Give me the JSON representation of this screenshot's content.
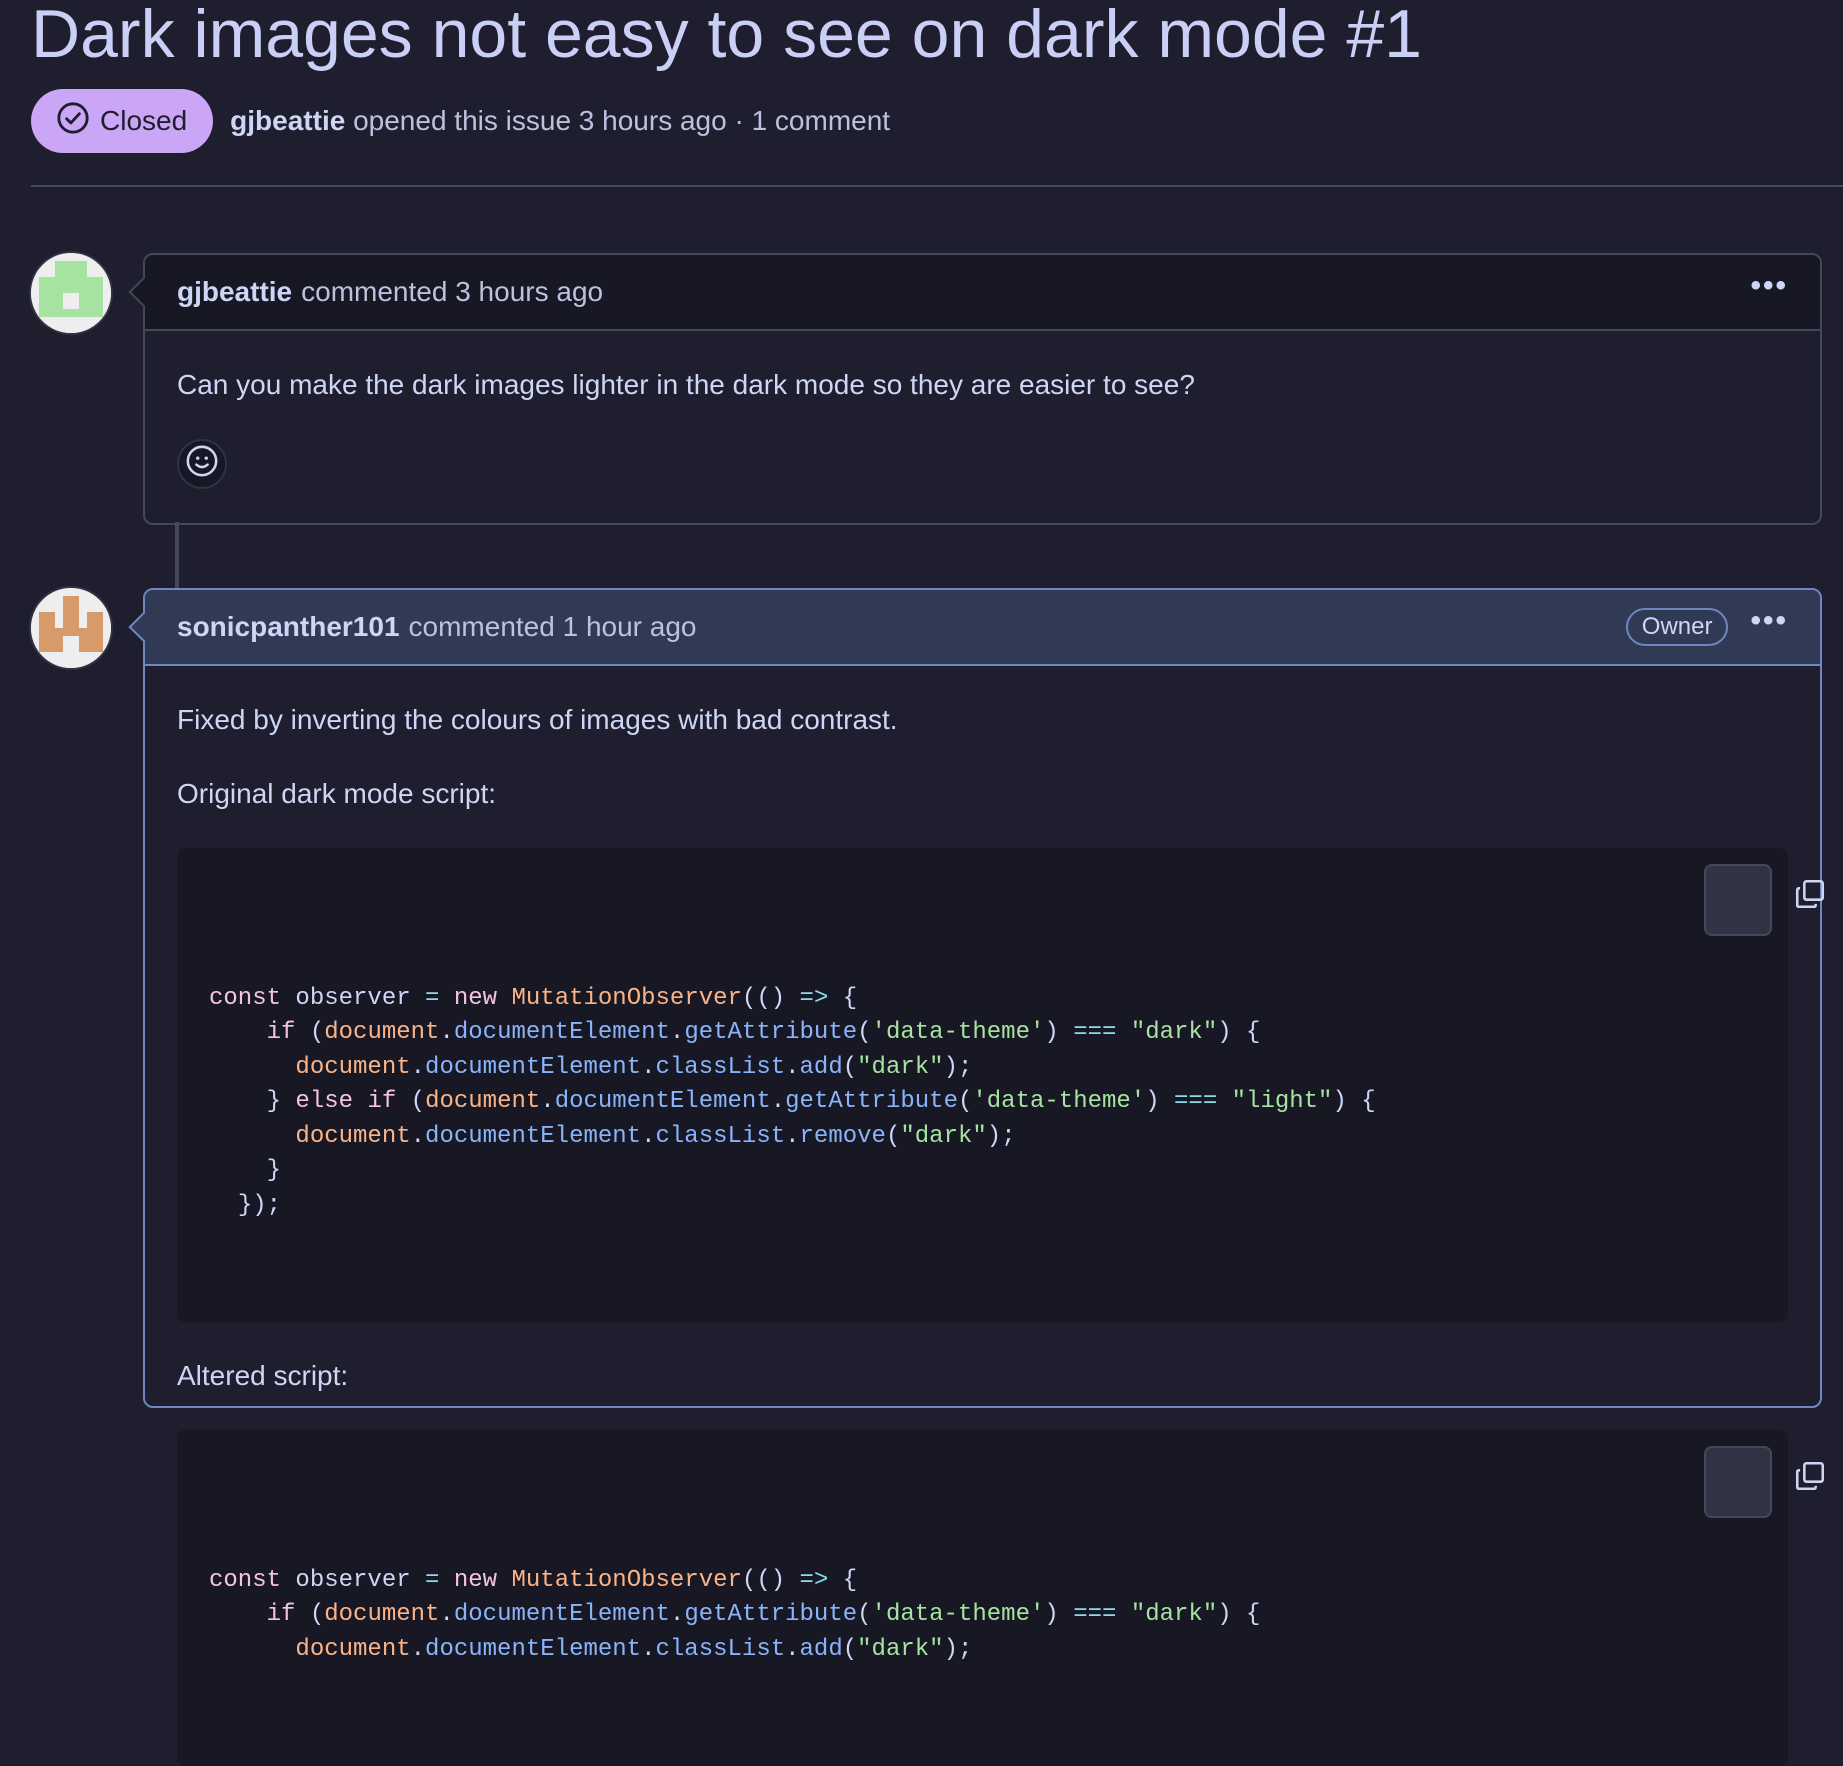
{
  "issue": {
    "title": "Dark images not easy to see on dark mode #1",
    "state": "Closed",
    "author": "gjbeattie",
    "meta_text": "opened this issue 3 hours ago · 1 comment"
  },
  "comments": [
    {
      "author": "gjbeattie",
      "time_text": "commented 3 hours ago",
      "body": "Can you make the dark images lighter in the dark mode so they are easier to see?",
      "menu": "•••"
    },
    {
      "author": "sonicpanther101",
      "time_text": "commented 1 hour ago",
      "badge": "Owner",
      "menu": "•••",
      "para1": "Fixed by inverting the colours of images with bad contrast.",
      "para2": "Original dark mode script:",
      "para3": "Altered script:"
    }
  ],
  "code_original": [
    "const observer = new MutationObserver(() => {",
    "    if (document.documentElement.getAttribute('data-theme') === \"dark\") {",
    "      document.documentElement.classList.add(\"dark\");",
    "    } else if (document.documentElement.getAttribute('data-theme') === \"light\") {",
    "      document.documentElement.classList.remove(\"dark\");",
    "    }",
    "  });"
  ],
  "code_altered": [
    "const observer = new MutationObserver(() => {",
    "    if (document.documentElement.getAttribute('data-theme') === \"dark\") {",
    "      document.documentElement.classList.add(\"dark\");"
  ],
  "colors": {
    "background": "#1e1e2e",
    "closed_badge": "#cba6f7",
    "owner_header": "#313a55",
    "owner_border": "#7086c2"
  },
  "icons": {
    "state": "check-circle-icon",
    "reaction": "smiley-icon",
    "copy": "copy-icon",
    "menu": "kebab-icon"
  }
}
